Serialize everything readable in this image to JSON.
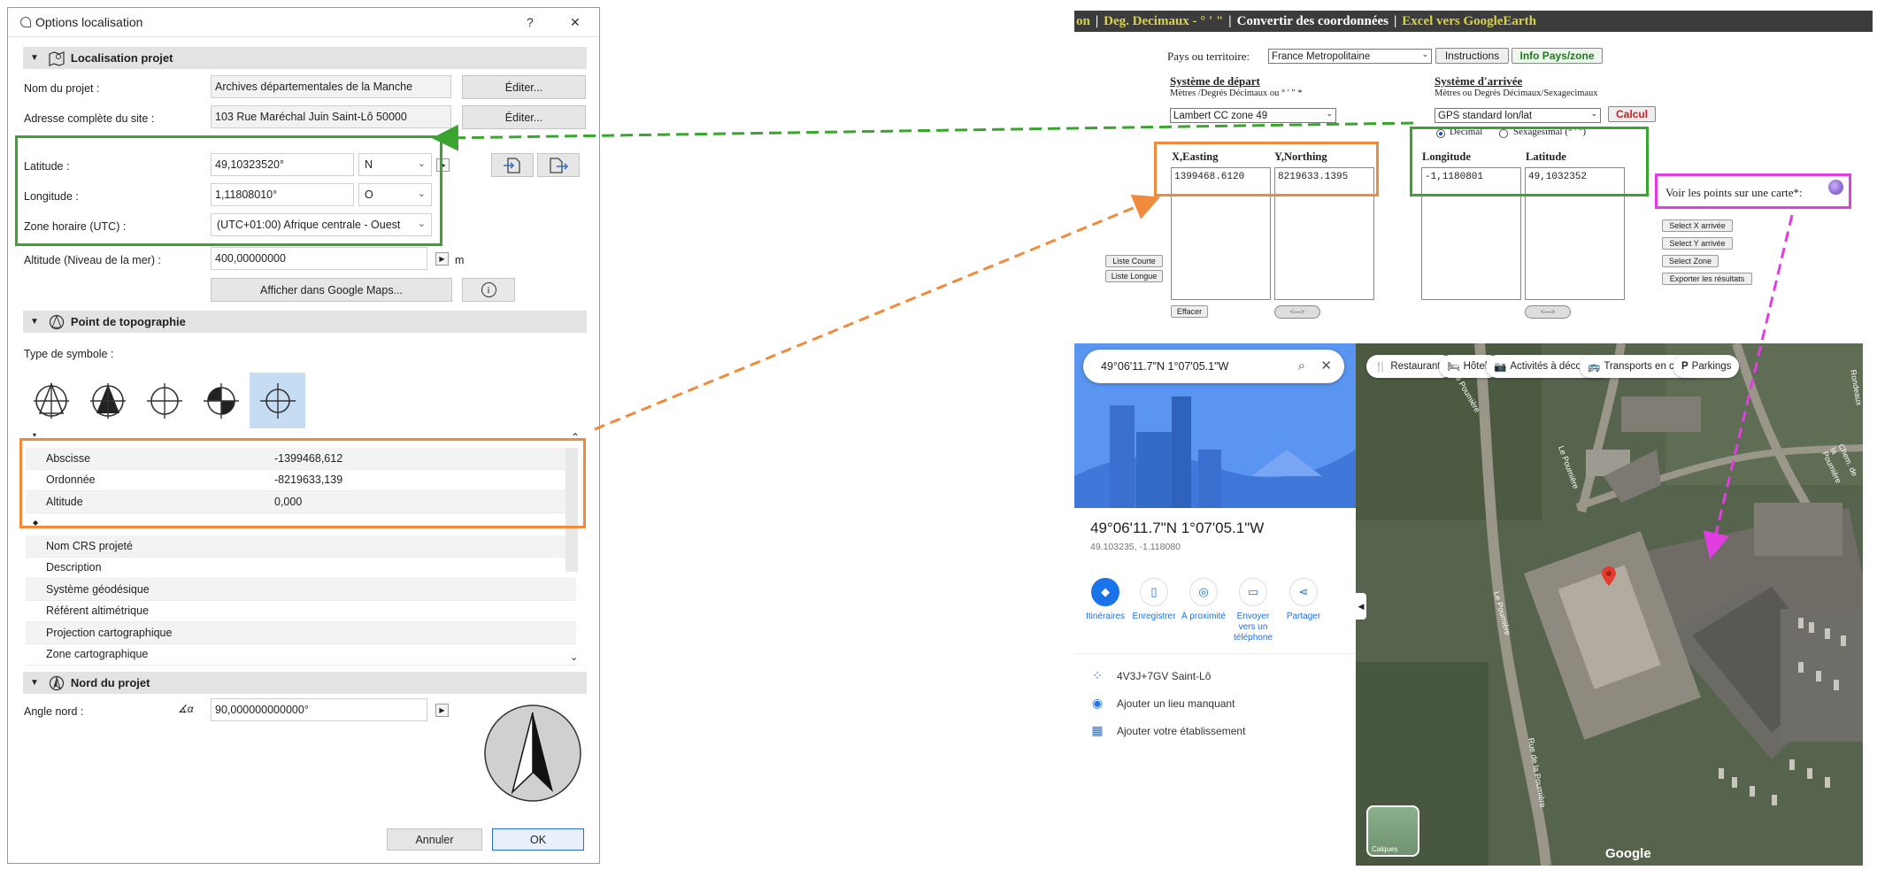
{
  "dialog": {
    "title": "Options localisation",
    "help": "?",
    "close": "✕",
    "section_location": "Localisation projet",
    "project_name_label": "Nom du projet :",
    "project_name_value": "Archives départementales de la Manche",
    "edit_label": "Éditer...",
    "address_label": "Adresse complète du site :",
    "address_value": "103 Rue Maréchal Juin Saint-Lô 50000",
    "latitude_label": "Latitude :",
    "latitude_value": "49,10323520°",
    "latitude_dir": "N",
    "longitude_label": "Longitude :",
    "longitude_value": "1,11808010°",
    "longitude_dir": "O",
    "timezone_label": "Zone horaire (UTC) :",
    "timezone_value": "(UTC+01:00) Afrique centrale - Ouest",
    "altitude_label": "Altitude (Niveau de la mer) :",
    "altitude_value": "400,00000000",
    "altitude_unit": "m",
    "google_maps_button": "Afficher dans Google Maps...",
    "info_button": "i",
    "section_survey": "Point de topographie",
    "symbol_type_label": "Type de symbole :",
    "coords_table": [
      {
        "key": "Abscisse",
        "value": "-1399468,612"
      },
      {
        "key": "Ordonnée",
        "value": "-8219633,139"
      },
      {
        "key": "Altitude",
        "value": "0,000"
      }
    ],
    "crs_table": [
      {
        "key": "Nom CRS projeté",
        "value": ""
      },
      {
        "key": "Description",
        "value": ""
      },
      {
        "key": "Système géodésique",
        "value": ""
      },
      {
        "key": "Référent altimétrique",
        "value": ""
      },
      {
        "key": "Projection cartographique",
        "value": ""
      },
      {
        "key": "Zone cartographique",
        "value": ""
      }
    ],
    "section_north": "Nord du projet",
    "north_angle_label": "Angle nord :",
    "north_angle_value": "90,000000000000°",
    "cancel_button": "Annuler",
    "ok_button": "OK"
  },
  "converter": {
    "tabs": [
      "on",
      "Deg. Decimaux - ° ' \"",
      "Convertir des coordonnées",
      "Excel vers GoogleEarth"
    ],
    "country_label": "Pays ou territoire:",
    "country_value": "France Metropolitaine",
    "instructions_button": "Instructions",
    "info_button": "Info Pays/zone",
    "start_system_title": "Système de départ",
    "start_system_sub": "Mètres /Degrés Décimaux ou ° ' \" *",
    "start_system_value": "Lambert CC zone 49",
    "end_system_title": "Système d'arrivée",
    "end_system_sub": "Mètres ou Degrés Décimaux/Sexagecimaux",
    "end_system_value": "GPS standard lon/lat",
    "calcul_button": "Calcul",
    "decimal_label": "Decimal",
    "sexagesimal_label": "Sexagesimal (° ' \")",
    "x_header": "X,Easting",
    "y_header": "Y,Northing",
    "x_value": "1399468.6120",
    "y_value": "8219633.1395",
    "lon_header": "Longitude",
    "lat_header": "Latitude",
    "lon_value": "-1,1180801",
    "lat_value": "49,1032352",
    "short_list_button": "Liste Courte",
    "long_list_button": "Liste Longue",
    "clear_button": "Effacer",
    "swap_pill": "<--->",
    "map_link_label": "Voir les points sur une carte*:",
    "side_buttons": [
      "Select X arrivée",
      "Select Y arrivée",
      "Select Zone",
      "Exporter les résultats"
    ]
  },
  "maps": {
    "search_value": "49°06'11.7\"N 1°07'05.1\"W",
    "place_title": "49°06'11.7\"N 1°07'05.1\"W",
    "place_sub": "49.103235, -1.118080",
    "actions": [
      "Itinéraires",
      "Enregistrer",
      "À proximité",
      "Envoyer vers un téléphone",
      "Partager"
    ],
    "plus_code": "4V3J+7GV Saint-Lô",
    "add_place": "Ajouter un lieu manquant",
    "add_business": "Ajouter votre établissement",
    "chips": [
      "Restaurants",
      "Hôtels",
      "Activités à découvrir",
      "Transports en com...",
      "Parkings"
    ],
    "layers_label": "Calques",
    "google_logo": "Google",
    "street_labels": [
      "Le Poumière",
      "Le Poumière",
      "Le Poumière",
      "Rue de la Poumière",
      "Chem. de la Poumière",
      "Rondeaux"
    ]
  },
  "colors": {
    "green": "#3aa52e",
    "orange": "#f08a3c",
    "magenta": "#e03ee0",
    "accent_blue": "#1a73e8",
    "calcul_red": "#cc1f1f"
  }
}
